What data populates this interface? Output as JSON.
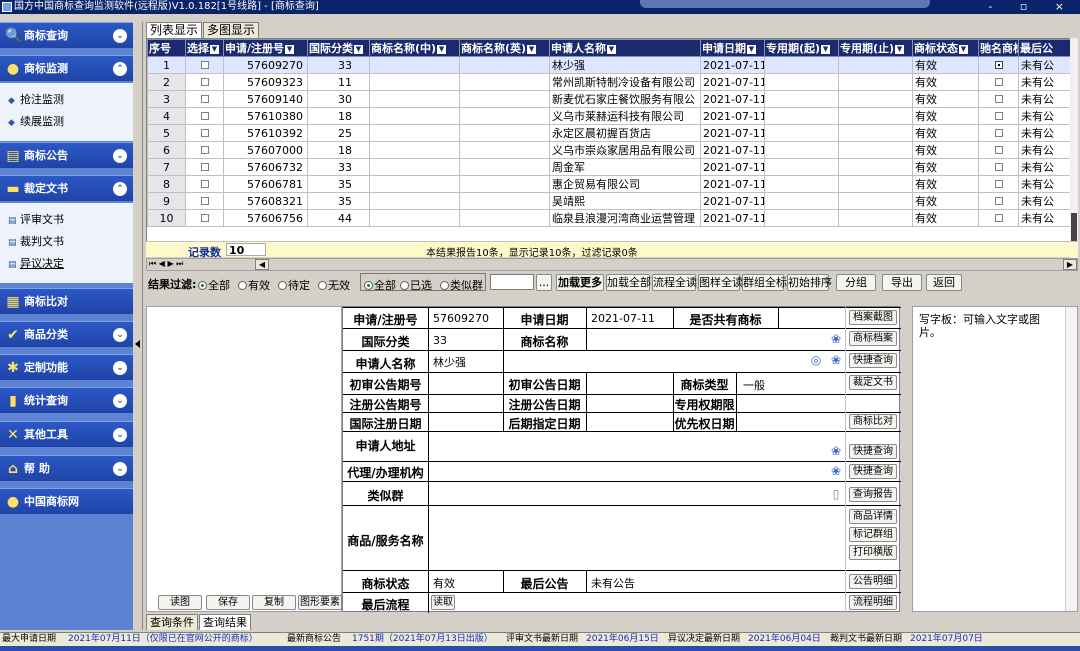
{
  "window": {
    "title": "国方中国商标查询监测软件(远程版)V1.0.182[1号线路] - [商标查询]",
    "controls": "- ▫ ×"
  },
  "sidebar": {
    "sections": [
      {
        "label": "商标查询",
        "icon": "search-icon",
        "chev": "⌄"
      },
      {
        "label": "商标监测",
        "icon": "monitor-icon",
        "chev": "⌃",
        "items": [
          {
            "label": "抢注监测"
          },
          {
            "label": "续展监测"
          }
        ]
      },
      {
        "label": "商标公告",
        "icon": "bulletin-icon",
        "chev": "⌄"
      },
      {
        "label": "裁定文书",
        "icon": "document-icon",
        "chev": "⌃",
        "items": [
          {
            "label": "评审文书"
          },
          {
            "label": "裁判文书"
          },
          {
            "label": "异议决定"
          }
        ]
      },
      {
        "label": "商标比对",
        "icon": "compare-icon",
        "chev": ""
      },
      {
        "label": "商品分类",
        "icon": "category-icon",
        "chev": "⌄"
      },
      {
        "label": "定制功能",
        "icon": "custom-icon",
        "chev": "⌄"
      },
      {
        "label": "统计查询",
        "icon": "stats-icon",
        "chev": "⌄"
      },
      {
        "label": "其他工具",
        "icon": "tools-icon",
        "chev": "⌄"
      },
      {
        "label": "帮 助",
        "icon": "help-icon",
        "chev": "⌄"
      },
      {
        "label": "中国商标网",
        "icon": "globe-icon",
        "chev": ""
      }
    ]
  },
  "tabs": {
    "list": "列表显示",
    "multi": "多图显示"
  },
  "grid": {
    "columns": [
      "序号",
      "选择",
      "申请/注册号",
      "国际分类",
      "商标名称(中)",
      "商标名称(英)",
      "申请人名称",
      "申请日期",
      "专用期(起)",
      "专用期(止)",
      "商标状态",
      "驰名商标",
      "最后公"
    ],
    "rows": [
      {
        "no": "1",
        "reg": "57609270",
        "cls": "33",
        "applicant": "林少强",
        "date": "2021-07-11",
        "status": "有效",
        "last": "未有公"
      },
      {
        "no": "2",
        "reg": "57609323",
        "cls": "11",
        "applicant": "常州凯斯特制冷设备有限公司",
        "date": "2021-07-11",
        "status": "有效",
        "last": "未有公"
      },
      {
        "no": "3",
        "reg": "57609140",
        "cls": "30",
        "applicant": "新麦优石家庄餐饮服务有限公",
        "date": "2021-07-11",
        "status": "有效",
        "last": "未有公"
      },
      {
        "no": "4",
        "reg": "57610380",
        "cls": "18",
        "applicant": "义乌市莱赫运科技有限公司",
        "date": "2021-07-11",
        "status": "有效",
        "last": "未有公"
      },
      {
        "no": "5",
        "reg": "57610392",
        "cls": "25",
        "applicant": "永定区晨初握百货店",
        "date": "2021-07-11",
        "status": "有效",
        "last": "未有公"
      },
      {
        "no": "6",
        "reg": "57607000",
        "cls": "18",
        "applicant": "义乌市崇焱家居用品有限公司",
        "date": "2021-07-11",
        "status": "有效",
        "last": "未有公"
      },
      {
        "no": "7",
        "reg": "57606732",
        "cls": "33",
        "applicant": "周金军",
        "date": "2021-07-11",
        "status": "有效",
        "last": "未有公"
      },
      {
        "no": "8",
        "reg": "57606781",
        "cls": "35",
        "applicant": "惠企贸易有限公司",
        "date": "2021-07-11",
        "status": "有效",
        "last": "未有公"
      },
      {
        "no": "9",
        "reg": "57608321",
        "cls": "35",
        "applicant": "吴靖熙",
        "date": "2021-07-11",
        "status": "有效",
        "last": "未有公"
      },
      {
        "no": "10",
        "reg": "57606756",
        "cls": "44",
        "applicant": "临泉县浪漫河湾商业运营管理",
        "date": "2021-07-11",
        "status": "有效",
        "last": "未有公"
      }
    ],
    "record_label": "记录数",
    "record_count": "10",
    "summary": "本结果报告10条，显示记录10条，过滤记录0条"
  },
  "filter": {
    "label": "结果过滤:",
    "status_options": [
      "全部",
      "有效",
      "待定",
      "无效"
    ],
    "status_selected": "全部",
    "type_options": [
      "全部",
      "已选",
      "类似群"
    ],
    "type_selected": "全部",
    "input_value": "",
    "ellipsis": "...",
    "buttons": [
      "加载更多",
      "加载全部",
      "流程全读",
      "图样全读",
      "群组全标",
      "初始排序",
      "分组",
      "导出",
      "返回"
    ]
  },
  "detail": {
    "labels": {
      "reg_no": "申请/注册号",
      "app_date": "申请日期",
      "shared": "是否共有商标",
      "intl_class": "国际分类",
      "tm_name": "商标名称",
      "applicant": "申请人名称",
      "prelim_no": "初审公告期号",
      "prelim_date": "初审公告日期",
      "tm_type": "商标类型",
      "reg_ann_no": "注册公告期号",
      "reg_ann_date": "注册公告日期",
      "excl_period": "专用权期限",
      "intl_reg_date": "国际注册日期",
      "later_date": "后期指定日期",
      "priority_date": "优先权日期",
      "address": "申请人地址",
      "agent": "代理/办理机构",
      "similar": "类似群",
      "goods": "商品/服务名称",
      "status": "商标状态",
      "last_ann": "最后公告",
      "last_flow": "最后流程"
    },
    "values": {
      "reg_no": "57609270",
      "app_date": "2021-07-11",
      "intl_class": "33",
      "applicant": "林少强",
      "tm_type": "一般",
      "status": "有效",
      "last_ann": "未有公告"
    },
    "buttons": {
      "archive_img": "档案截图",
      "archive": "商标档案",
      "quick1": "快捷查询",
      "ruling": "裁定文书",
      "compare": "商标比对",
      "quick2": "快捷查询",
      "quick3": "快捷查询",
      "report": "查询报告",
      "goods_detail": "商品详情",
      "mark_group": "标记群组",
      "print": "打印横版",
      "ann_detail": "公告明细",
      "flow_detail": "流程明细",
      "read": "读取"
    }
  },
  "notepad": {
    "text": "写字板：可输入文字或图片。"
  },
  "left_buttons": [
    "读图",
    "保存",
    "复制",
    "图形要素"
  ],
  "bottom_tabs": [
    "查询条件",
    "查询结果"
  ],
  "status": {
    "a_label": "最大申请日期",
    "a_value": "2021年07月11日（仅限已在官网公开的商标）",
    "b_label": "最新商标公告",
    "b_value": "1751期（2021年07月13日出版）",
    "c_label": "评审文书最新日期",
    "c_value": "2021年06月15日",
    "d_label": "异议决定最新日期",
    "d_value": "2021年06月04日",
    "e_label": "裁判文书最新日期",
    "e_value": "2021年07月07日"
  },
  "colors": {
    "grid_header": "#1a2a6c",
    "sidebar_header": "#2c58c6",
    "title_bar": "#0a246a"
  }
}
